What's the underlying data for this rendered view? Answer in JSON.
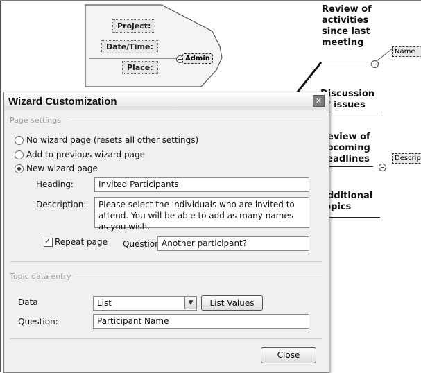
{
  "mindmap": {
    "template_labels": {
      "project": "Project:",
      "datetime": "Date/Time:",
      "place": "Place:",
      "admin": "Admin"
    },
    "topics": [
      "Review of\nactivities\nsince last\nmeeting",
      "Discussion\nof issues",
      "Review of\nupcoming\ndeadlines",
      "Additional\ntopics"
    ],
    "chips": {
      "name": "Name",
      "description": "Descrip"
    }
  },
  "dialog": {
    "title": "Wizard Customization",
    "close_icon": "close-icon",
    "page_settings": {
      "section_label": "Page settings",
      "options": [
        {
          "label": "No wizard page (resets all other settings)",
          "selected": false
        },
        {
          "label": "Add to previous wizard page",
          "selected": false
        },
        {
          "label": "New wizard page",
          "selected": true
        }
      ],
      "heading_label": "Heading:",
      "heading_value": "Invited Participants",
      "description_label": "Description:",
      "description_value": "Please select the individuals who are invited to attend. You will be able to add as many names as you wish.",
      "repeat_label": "Repeat page",
      "repeat_checked": true,
      "question_label": "Question:",
      "question_value": "Another participant?"
    },
    "topic_data": {
      "section_label": "Topic data entry",
      "data_label": "Data",
      "data_value": "List",
      "list_values_button": "List Values",
      "question_label": "Question:",
      "question_value": "Participant Name"
    },
    "close_button": "Close"
  }
}
